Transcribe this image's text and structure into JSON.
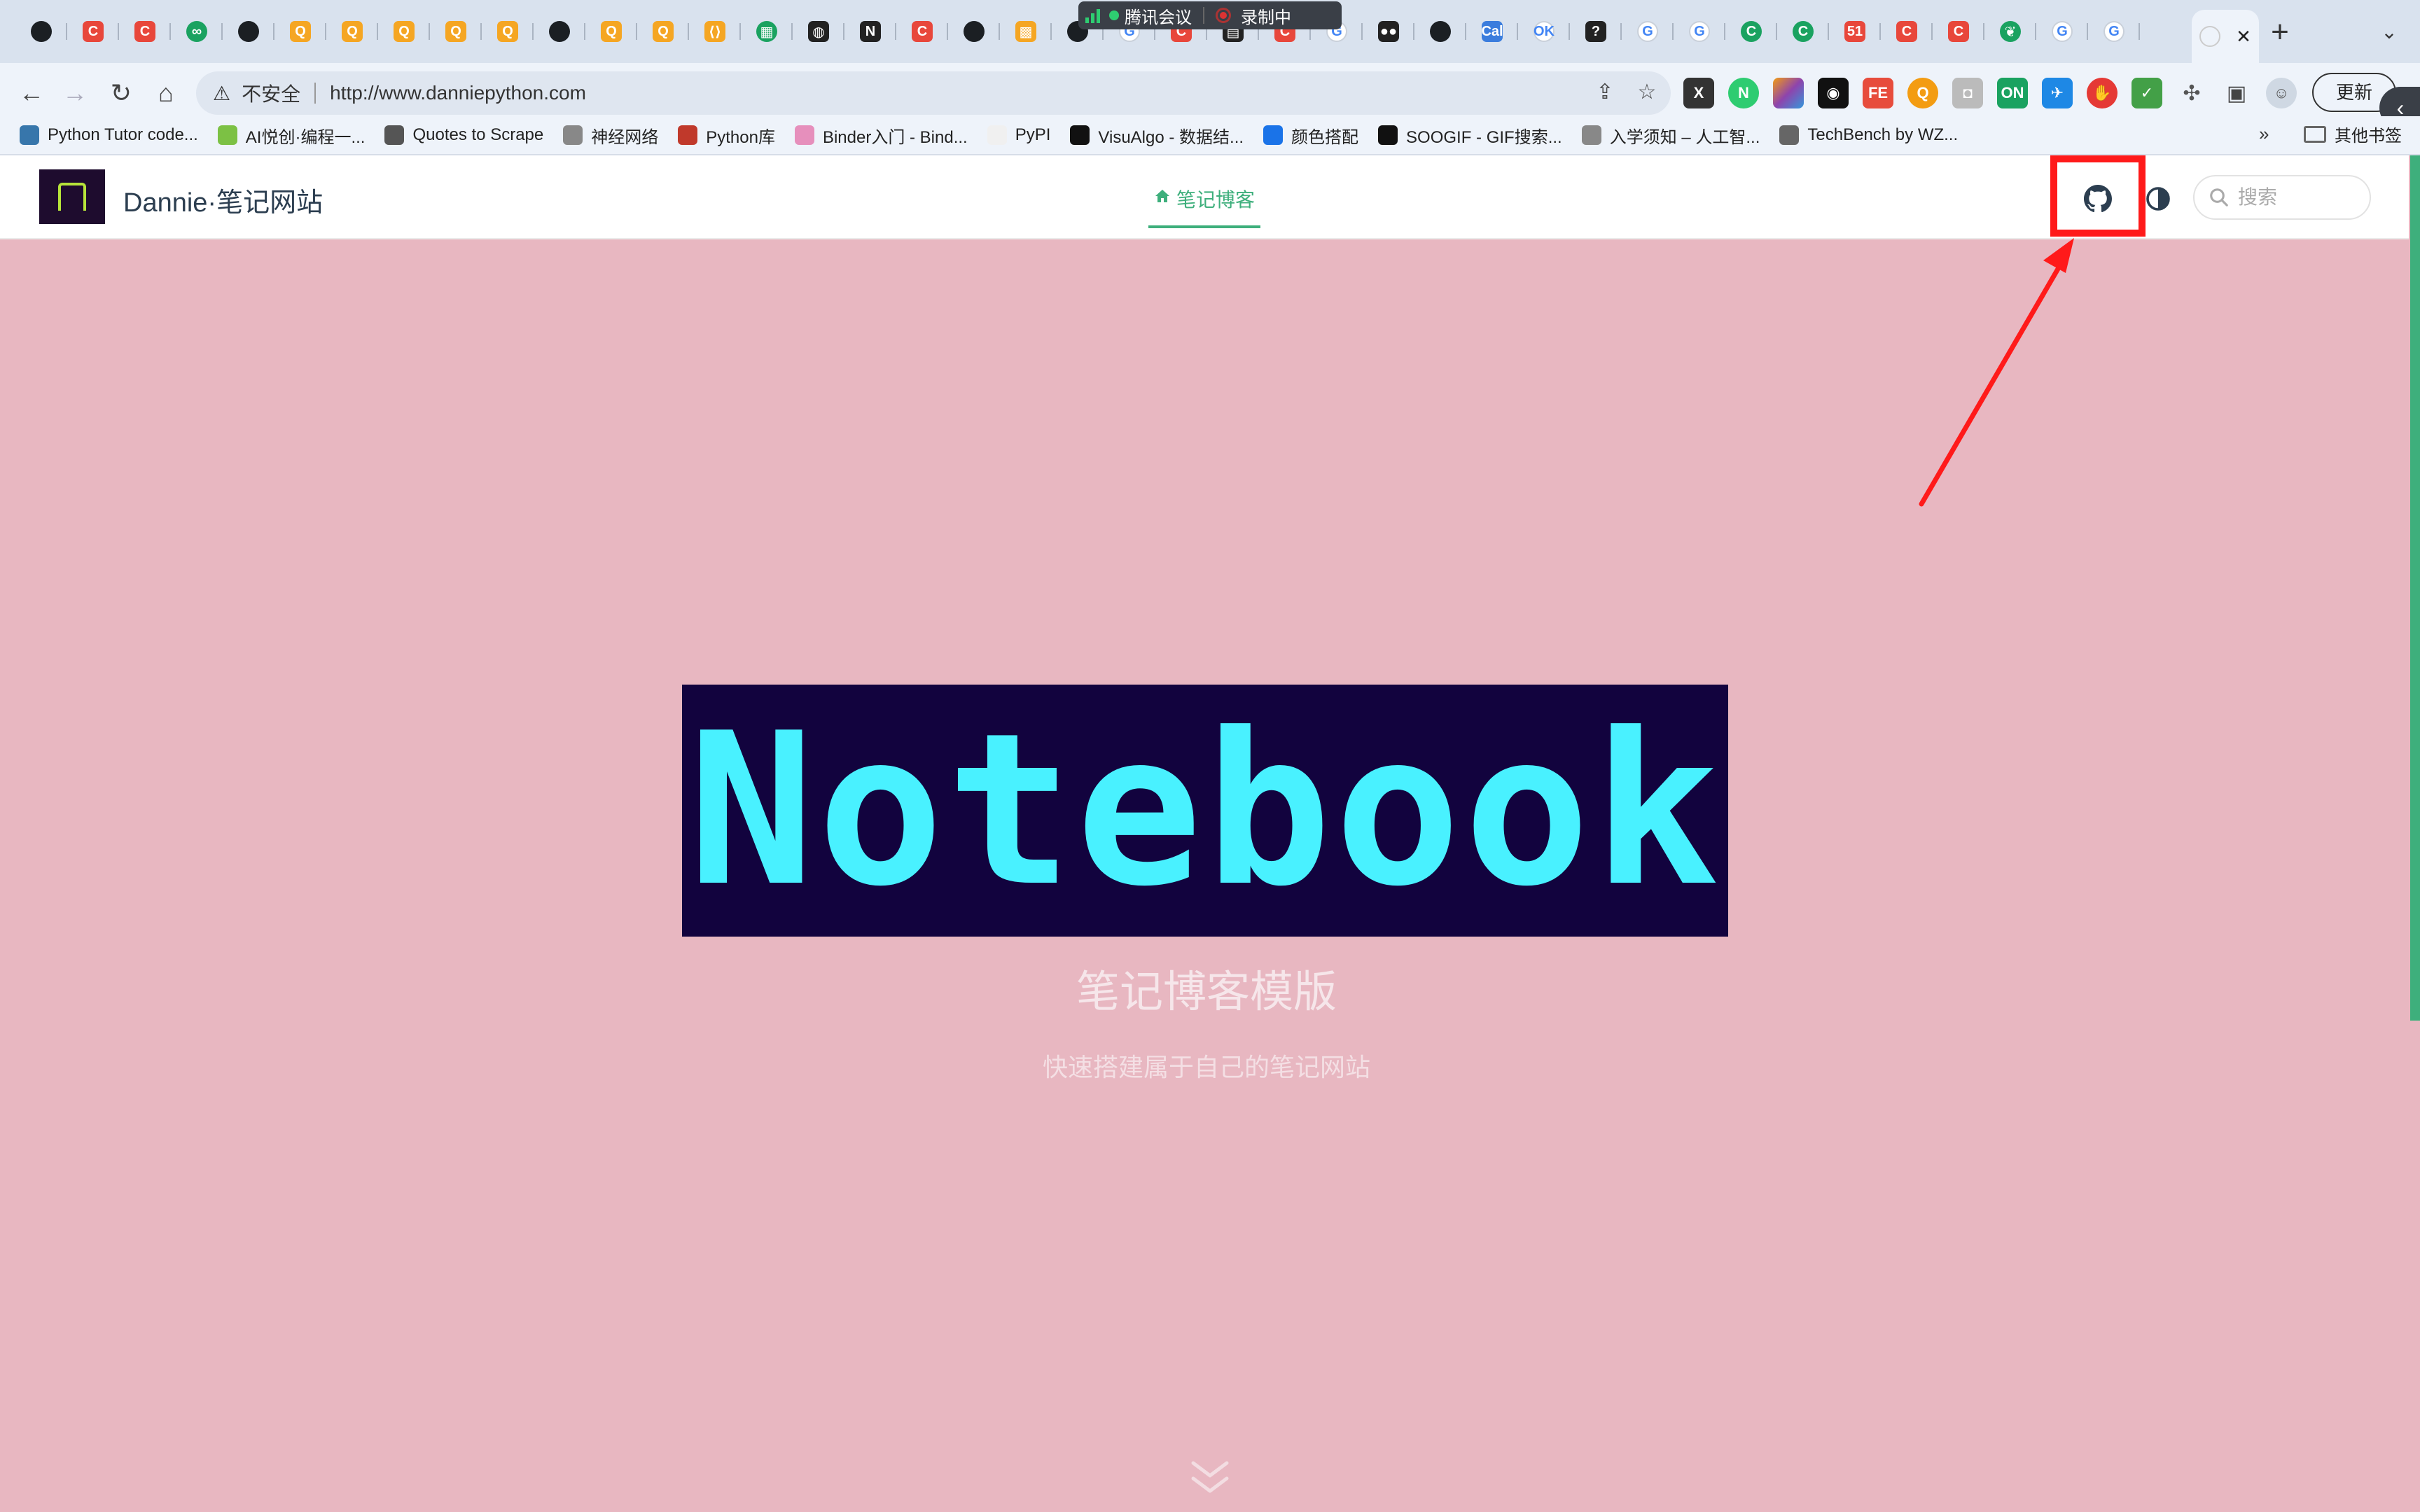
{
  "browser": {
    "meeting_overlay": {
      "app": "腾讯会议",
      "recording": "录制中"
    },
    "tab_favicons": [
      "github-icon",
      "c-icon",
      "c-icon",
      "link-icon",
      "github-icon",
      "qiniu-icon",
      "qiniu-icon",
      "qiniu-icon",
      "qiniu-icon",
      "qiniu-icon",
      "github-icon",
      "qiniu-icon",
      "qiniu-icon",
      "code-icon",
      "chart-icon",
      "globe-icon",
      "notion-icon",
      "c-icon",
      "github-icon",
      "image-icon",
      "github-icon",
      "google-icon",
      "c-icon",
      "book-icon",
      "c-icon",
      "google-icon",
      "medium-icon",
      "github-icon",
      "berkeley-icon",
      "ok-icon",
      "question-icon",
      "google-icon",
      "google-icon",
      "green-c-icon",
      "green-c-icon",
      "51-icon",
      "c-icon",
      "c-icon",
      "leaf-icon",
      "google-icon",
      "google-icon"
    ],
    "active_tab": {
      "close": "✕"
    },
    "new_tab": "+",
    "address": {
      "security_label": "不安全",
      "url": "http://www.danniepython.com"
    },
    "update_button": "更新",
    "bookmarks": [
      {
        "label": "Python Tutor code...",
        "color": "#3776ab"
      },
      {
        "label": "AI悦创·编程一...",
        "color": "#7cc144"
      },
      {
        "label": "Quotes to Scrape",
        "color": "#555555"
      },
      {
        "label": "神经网络",
        "color": "#888888"
      },
      {
        "label": "Python库",
        "color": "#c0392b"
      },
      {
        "label": "Binder入门 - Bind...",
        "color": "#e68fbc"
      },
      {
        "label": "PyPI",
        "color": "#f0f0f0"
      },
      {
        "label": "VisuAlgo - 数据结...",
        "color": "#111111"
      },
      {
        "label": "颜色搭配",
        "color": "#1a73e8"
      },
      {
        "label": "SOOGIF - GIF搜索...",
        "color": "#111111"
      },
      {
        "label": "入学须知 – 人工智...",
        "color": "#888888"
      },
      {
        "label": "TechBench by WZ...",
        "color": "#666666"
      }
    ],
    "bookmarks_more": "»",
    "other_bookmarks": "其他书签"
  },
  "site": {
    "title": "Dannie·笔记网站",
    "nav_home": "笔记博客",
    "search_placeholder": "搜索",
    "hero_word": "Notebook",
    "hero_title": "笔记博客模版",
    "hero_subtitle": "快速搭建属于自己的笔记网站"
  },
  "colors": {
    "page_bg": "#e8b7c1",
    "accent": "#3eaf7c",
    "banner_bg": "#12033e",
    "banner_text": "#49f1ff",
    "annotation": "#ff1a1a"
  }
}
